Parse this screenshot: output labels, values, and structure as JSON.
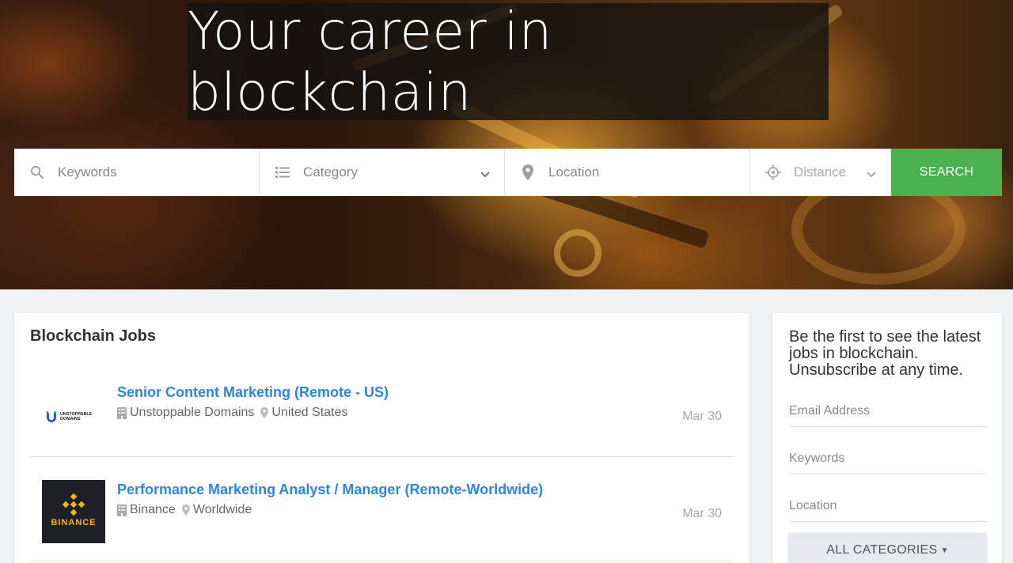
{
  "hero": {
    "title": "Your career in blockchain"
  },
  "search": {
    "keywords_placeholder": "Keywords",
    "category_placeholder": "Category",
    "location_placeholder": "Location",
    "distance_placeholder": "Distance",
    "button_label": "SEARCH",
    "icons": [
      "search-icon",
      "list-icon",
      "location-pin-icon",
      "crosshair-icon",
      "chevron-down-icon"
    ],
    "button_color": "#4caf50"
  },
  "jobs": {
    "heading": "Blockchain Jobs",
    "items": [
      {
        "title": "Senior Content Marketing (Remote - US)",
        "company": "Unstoppable Domains",
        "location": "United States",
        "date": "Mar 30",
        "logo_text": [
          "UNSTOPPABLE",
          "DOMAINS"
        ]
      },
      {
        "title": "Performance Marketing Analyst / Manager (Remote-Worldwide)",
        "company": "Binance",
        "location": "Worldwide",
        "date": "Mar 30",
        "logo_text": [
          "BINANCE"
        ]
      }
    ],
    "title_color": "#2e86de"
  },
  "subscribe": {
    "text": "Be the first to see the latest jobs in blockchain. Unsubscribe at any time.",
    "email_placeholder": "Email Address",
    "keywords_placeholder": "Keywords",
    "location_placeholder": "Location",
    "categories_button": "ALL CATEGORIES"
  }
}
